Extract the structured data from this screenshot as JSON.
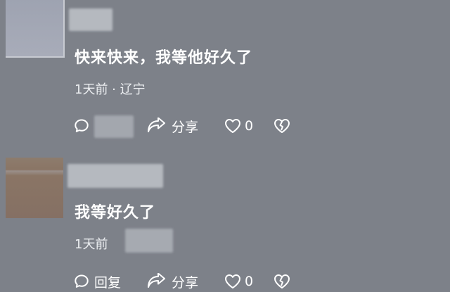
{
  "comments": [
    {
      "text": "快来快来，我等他好久了",
      "meta": "1天前 · 辽宁",
      "actions": {
        "share_label": "分享",
        "like_count": "0"
      }
    },
    {
      "text": "我等好久了",
      "meta": "1天前",
      "actions": {
        "reply_label": "回复",
        "share_label": "分享",
        "like_count": "0"
      }
    }
  ],
  "colors": {
    "background": "#7d8189",
    "text": "#ffffff"
  },
  "icons": [
    "comment-bubble-icon",
    "share-arrow-icon",
    "heart-icon",
    "broken-heart-icon"
  ]
}
